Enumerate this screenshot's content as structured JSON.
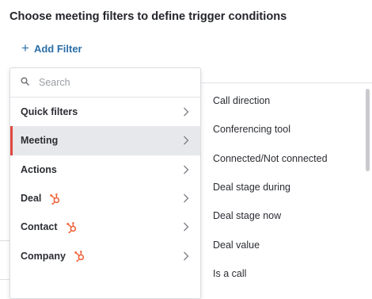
{
  "header": {
    "title": "Choose meeting filters to define trigger conditions"
  },
  "add_filter": {
    "icon": "plus-icon",
    "label": "Add Filter"
  },
  "search": {
    "placeholder": "Search",
    "value": ""
  },
  "menu": {
    "items": [
      {
        "label": "Quick filters",
        "active": false,
        "hubspot": false
      },
      {
        "label": "Meeting",
        "active": true,
        "hubspot": false
      },
      {
        "label": "Actions",
        "active": false,
        "hubspot": false
      },
      {
        "label": "Deal",
        "active": false,
        "hubspot": true
      },
      {
        "label": "Contact",
        "active": false,
        "hubspot": true
      },
      {
        "label": "Company",
        "active": false,
        "hubspot": true
      }
    ]
  },
  "submenu": {
    "items": [
      {
        "label": "Call direction"
      },
      {
        "label": "Conferencing tool"
      },
      {
        "label": "Connected/Not connected"
      },
      {
        "label": "Deal stage during"
      },
      {
        "label": "Deal stage now"
      },
      {
        "label": "Deal value"
      },
      {
        "label": "Is a call"
      }
    ]
  },
  "colors": {
    "accent": "#2a6fa8",
    "active_marker": "#e0473f",
    "hubspot": "#f0643c"
  }
}
